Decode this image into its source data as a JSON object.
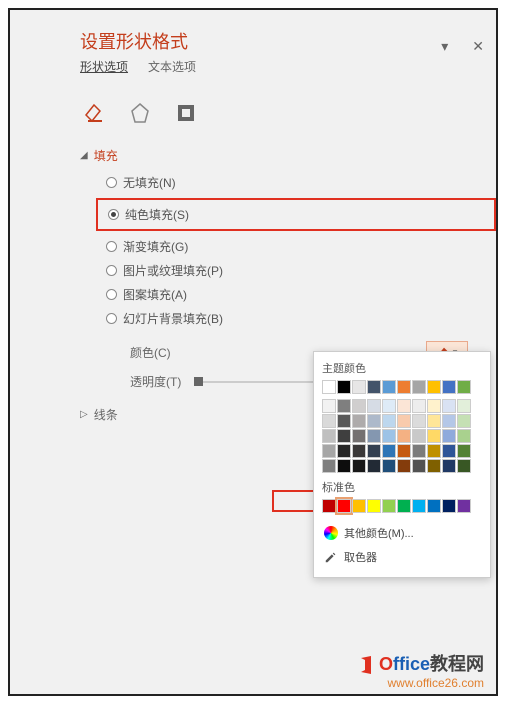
{
  "panel": {
    "title": "设置形状格式",
    "tabs": {
      "shape": "形状选项",
      "text": "文本选项"
    }
  },
  "sections": {
    "fill": {
      "label": "填充",
      "arrow": "◢"
    },
    "line": {
      "label": "线条",
      "arrow": "▷"
    }
  },
  "fillOptions": {
    "none": "无填充(N)",
    "solid": "纯色填充(S)",
    "gradient": "渐变填充(G)",
    "picture": "图片或纹理填充(P)",
    "pattern": "图案填充(A)",
    "slidebg": "幻灯片背景填充(B)"
  },
  "controls": {
    "color": "颜色(C)",
    "transparency": "透明度(T)"
  },
  "colorPopup": {
    "theme_label": "主题颜色",
    "standard_label": "标准色",
    "more": "其他颜色(M)...",
    "eyedropper": "取色器"
  },
  "chart_data": {
    "type": "table",
    "title": "主题颜色 / 标准色 色板",
    "theme_row": [
      "#ffffff",
      "#000000",
      "#e7e6e6",
      "#44546a",
      "#5b9bd5",
      "#ed7d31",
      "#a5a5a5",
      "#ffc000",
      "#4472c4",
      "#70ad47"
    ],
    "theme_shades": [
      [
        "#f2f2f2",
        "#7f7f7f",
        "#d0cece",
        "#d6dce5",
        "#deebf7",
        "#fbe5d6",
        "#ededed",
        "#fff2cc",
        "#d9e2f3",
        "#e2efda"
      ],
      [
        "#d9d9d9",
        "#595959",
        "#aeabab",
        "#adb9ca",
        "#bdd7ee",
        "#f8cbad",
        "#dbdbdb",
        "#ffe699",
        "#b4c7e7",
        "#c5e0b4"
      ],
      [
        "#bfbfbf",
        "#3f3f3f",
        "#757171",
        "#8497b0",
        "#9dc3e6",
        "#f4b183",
        "#c9c9c9",
        "#ffd966",
        "#8faadc",
        "#a9d18e"
      ],
      [
        "#a6a6a6",
        "#262626",
        "#3a3838",
        "#333f50",
        "#2e75b6",
        "#c55a11",
        "#7b7b7b",
        "#bf9000",
        "#2f5597",
        "#548235"
      ],
      [
        "#7f7f7f",
        "#0d0d0d",
        "#171717",
        "#222a35",
        "#1f4e79",
        "#843c0c",
        "#525252",
        "#7f6000",
        "#1f3864",
        "#385724"
      ]
    ],
    "standard": [
      "#c00000",
      "#ff0000",
      "#ffc000",
      "#ffff00",
      "#92d050",
      "#00b050",
      "#00b0f0",
      "#0070c0",
      "#002060",
      "#7030a0"
    ]
  },
  "watermark": {
    "brand_o": "O",
    "brand_ffice": "ffice",
    "brand_cn": "教程网",
    "url": "www.office26.com"
  }
}
